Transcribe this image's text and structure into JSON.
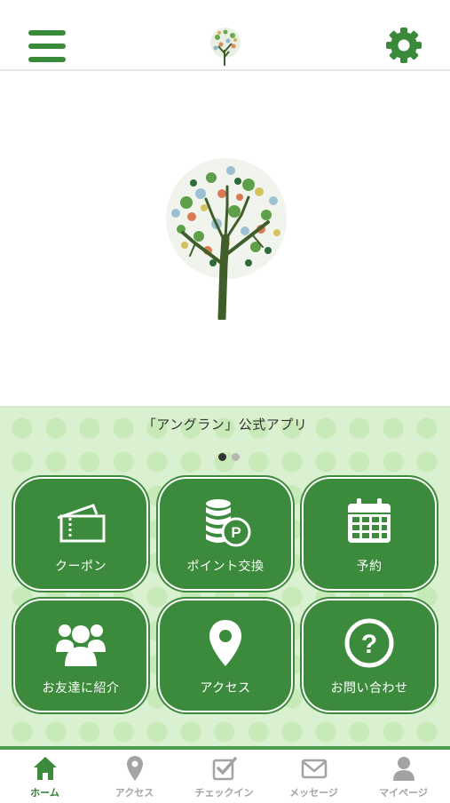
{
  "colors": {
    "accent": "#3c8a3c",
    "panel_bg": "#d9f1d0",
    "inactive": "#a3a3a3"
  },
  "header": {
    "menu_icon": "hamburger-menu-icon",
    "logo": "tree-logo",
    "settings_icon": "gear-icon"
  },
  "hero": {
    "image": "tree-illustration"
  },
  "panel": {
    "title": "「アングラン」公式アプリ",
    "pager": {
      "active_page": 1,
      "total_pages": 2
    },
    "tiles": [
      {
        "label": "クーポン",
        "icon": "ticket-icon"
      },
      {
        "label": "ポイント交換",
        "icon": "coins-points-icon"
      },
      {
        "label": "予約",
        "icon": "calendar-icon"
      },
      {
        "label": "お友達に紹介",
        "icon": "people-icon"
      },
      {
        "label": "アクセス",
        "icon": "location-pin-icon"
      },
      {
        "label": "お問い合わせ",
        "icon": "question-icon"
      }
    ]
  },
  "tabbar": {
    "items": [
      {
        "label": "ホーム",
        "icon": "home-icon",
        "active": true
      },
      {
        "label": "アクセス",
        "icon": "map-pin-icon",
        "active": false
      },
      {
        "label": "チェックイン",
        "icon": "checkin-icon",
        "active": false
      },
      {
        "label": "メッセージ",
        "icon": "envelope-icon",
        "active": false
      },
      {
        "label": "マイページ",
        "icon": "user-icon",
        "active": false
      }
    ]
  }
}
